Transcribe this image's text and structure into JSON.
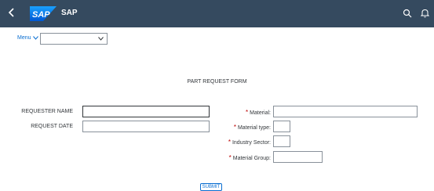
{
  "shell": {
    "title": "SAP",
    "logo_text": "SAP"
  },
  "nav": {
    "menu_label": "Menu",
    "select_value": ""
  },
  "form": {
    "title": "PART REQUEST FORM",
    "left": [
      {
        "label": "REQUESTER NAME",
        "value": ""
      },
      {
        "label": "REQUEST DATE",
        "value": ""
      }
    ],
    "right": [
      {
        "label": "Material:",
        "value": ""
      },
      {
        "label": "Material type:",
        "value": ""
      },
      {
        "label": "Industry Sector:",
        "value": ""
      },
      {
        "label": "Material Group:",
        "value": ""
      }
    ],
    "required_marker": "*",
    "submit_label": "SUBMIT"
  },
  "colors": {
    "shell": "#354a5f",
    "accent": "#0a6ed1",
    "required": "#bb0000",
    "logo": "#0070f2"
  }
}
